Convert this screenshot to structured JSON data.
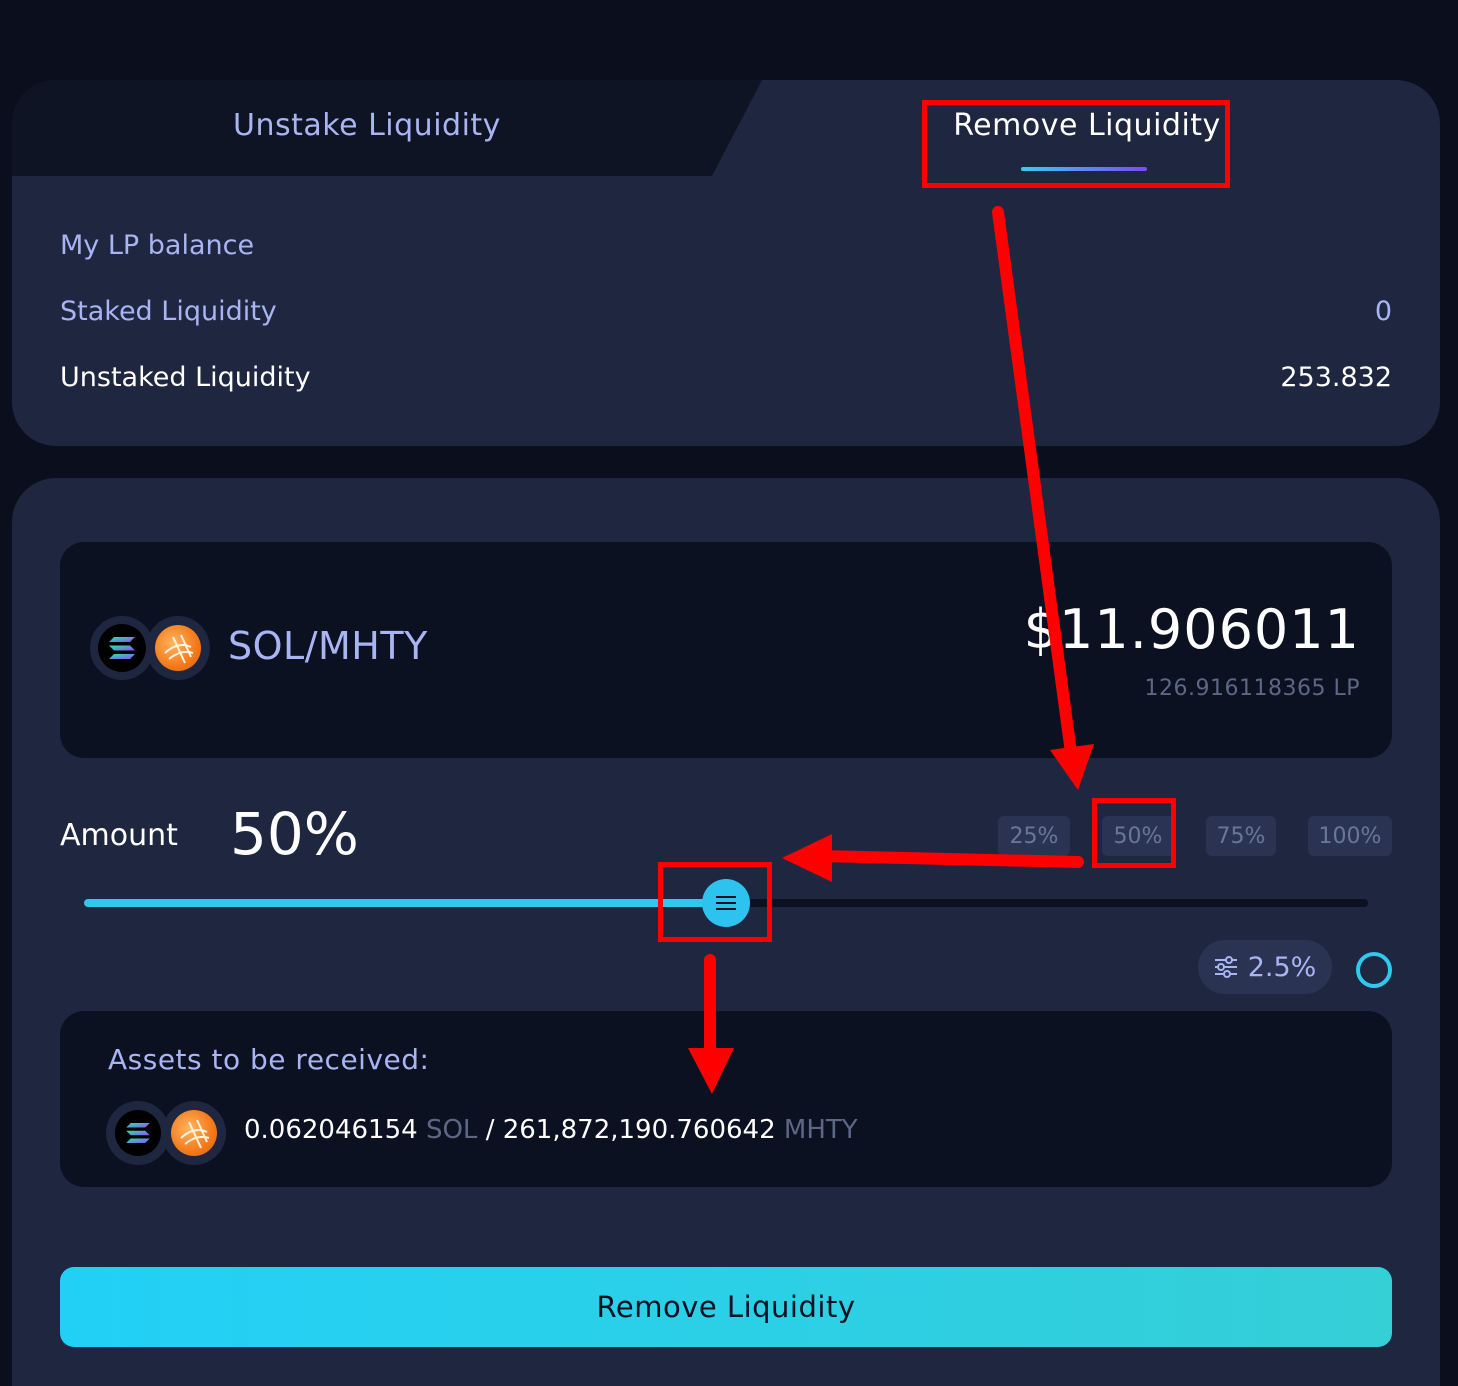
{
  "tabs": {
    "unstake_label": "Unstake Liquidity",
    "remove_label": "Remove Liquidity",
    "active": "Remove Liquidity"
  },
  "balance": {
    "heading": "My LP balance",
    "staked_label": "Staked Liquidity",
    "staked_value": "0",
    "unstaked_label": "Unstaked Liquidity",
    "unstaked_value": "253.832"
  },
  "pool": {
    "pair": "SOL/MHTY",
    "token_a_icon": "solana-icon",
    "token_b_icon": "mhty-icon",
    "usd_value": "$11.906011",
    "lp_amount": "126.916118365 LP"
  },
  "amount": {
    "label": "Amount",
    "percent": "50%",
    "percent_value": 50,
    "presets": [
      "25%",
      "50%",
      "75%",
      "100%"
    ],
    "selected_preset": "50%"
  },
  "slippage": {
    "value": "2.5%",
    "icon": "sliders-icon"
  },
  "assets": {
    "title": "Assets to be received:",
    "sol_amount": "0.062046154",
    "sol_unit": "SOL",
    "separator": "/",
    "mhty_amount": "261,872,190.760642",
    "mhty_unit": "MHTY"
  },
  "action": {
    "button_label": "Remove Liquidity"
  },
  "colors": {
    "accent": "#2ec3ef",
    "annotation": "#ff0000",
    "card": "#1e2640",
    "inner_box": "#0c1122"
  }
}
